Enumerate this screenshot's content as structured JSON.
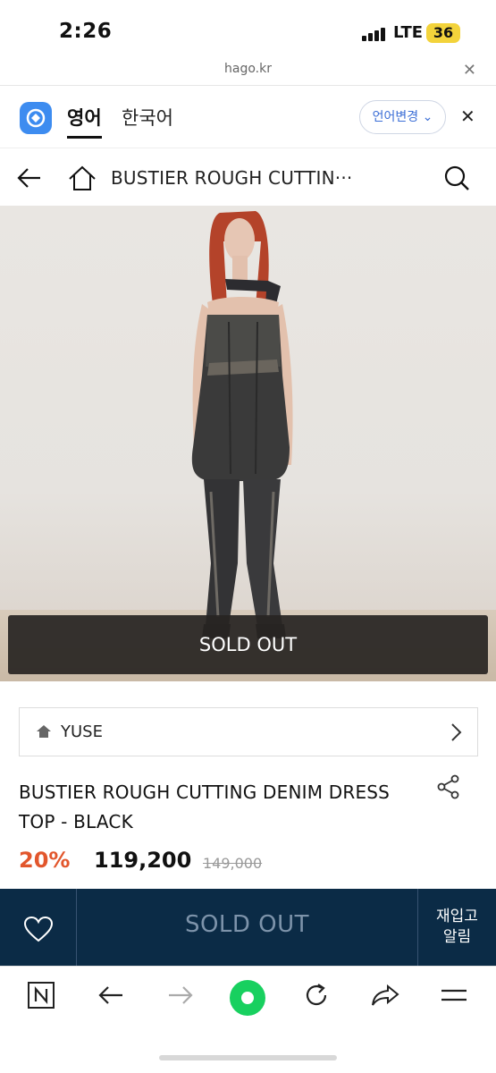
{
  "status": {
    "time": "2:26",
    "network": "LTE",
    "battery": "36"
  },
  "browser": {
    "url": "hago.kr"
  },
  "translate": {
    "lang_selected": "영어",
    "lang_other": "한국어",
    "change_label": "언어변경"
  },
  "header": {
    "title": "BUSTIER ROUGH CUTTIN···"
  },
  "product": {
    "image_overlay": "SOLD OUT",
    "brand": "YUSE",
    "title": "BUSTIER ROUGH CUTTING DENIM DRESS TOP - BLACK",
    "discount": "20%",
    "price": "119,200",
    "original_price": "149,000"
  },
  "buybar": {
    "sold_label": "SOLD OUT",
    "notify_line1": "재입고",
    "notify_line2": "알림"
  },
  "icons": [
    "back-arrow-icon",
    "home-icon",
    "search-icon",
    "share-icon",
    "heart-icon",
    "chevron-right-icon",
    "naver-n-icon",
    "forward-icon",
    "green-dot-icon",
    "reload-icon",
    "share-arrow-icon",
    "menu-icon"
  ],
  "colors": {
    "accent_navy": "#0b2b46",
    "discount_orange": "#e2562c",
    "translate_blue": "#3b6ed6"
  }
}
